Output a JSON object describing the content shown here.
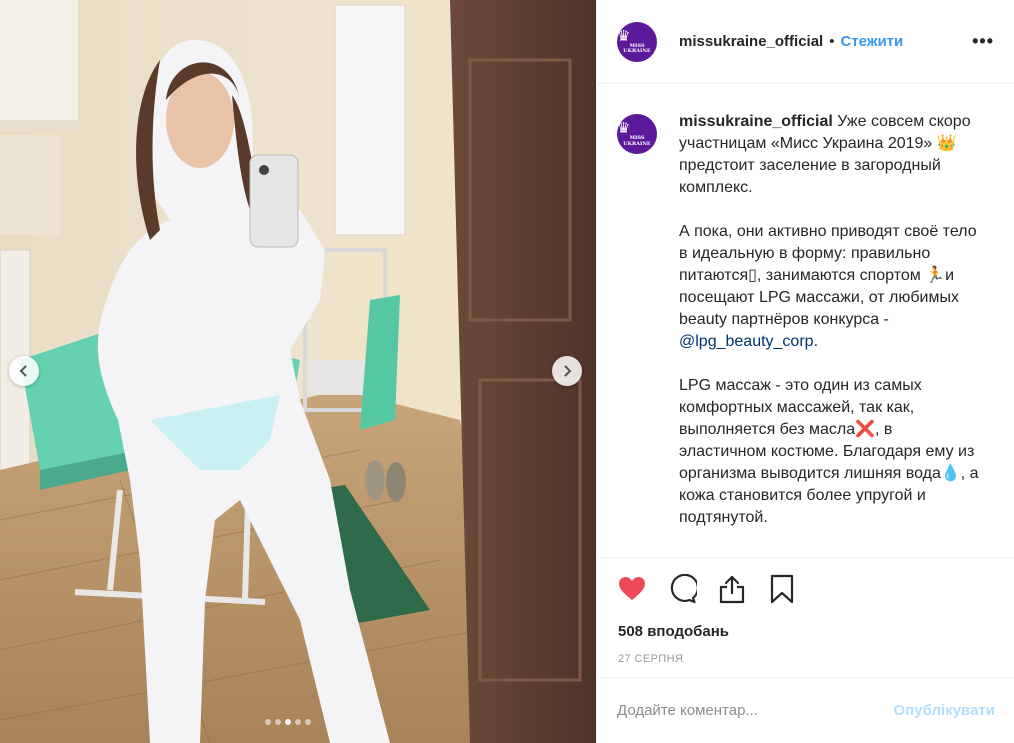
{
  "post": {
    "username": "missukraine_official",
    "separator": "•",
    "follow_label": "Стежити",
    "more_label": "•••",
    "avatar_text": "MISS UKRAINE"
  },
  "caption": {
    "username": "missukraine_official",
    "p1": " Уже совсем скоро участницам «Мисс Украина 2019» 👑 предстоит заселение в загородный комплекс.",
    "p2a": "А пока, они активно приводят своё тело в идеальную в форму: правильно питаются▯, занимаются спортом 🏃и посещают LPG массажи, от любимых beauty партнёров конкурса - ",
    "mention": "@lpg_beauty_corp",
    "p2b": ".",
    "p3": "LPG массаж - это один из самых комфортных массажей, так как, выполняется без масла❌, в эластичном костюме. Благодаря ему из организма выводится лишняя вода💧, а кожа становится более упругой и подтянутой."
  },
  "stats": {
    "likes": "508 вподобань",
    "date": "27 СЕРПНЯ"
  },
  "comment": {
    "placeholder": "Додайте коментар...",
    "publish_label": "Опублікувати"
  },
  "carousel": {
    "total": 5,
    "active_index": 2
  },
  "colors": {
    "like": "#ed4956",
    "follow": "#3897f0",
    "mention": "#003569",
    "publish_disabled": "#b2dffc"
  },
  "icons": [
    "chevron-left-icon",
    "chevron-right-icon",
    "heart-icon",
    "comment-icon",
    "share-icon",
    "bookmark-icon",
    "more-icon"
  ]
}
